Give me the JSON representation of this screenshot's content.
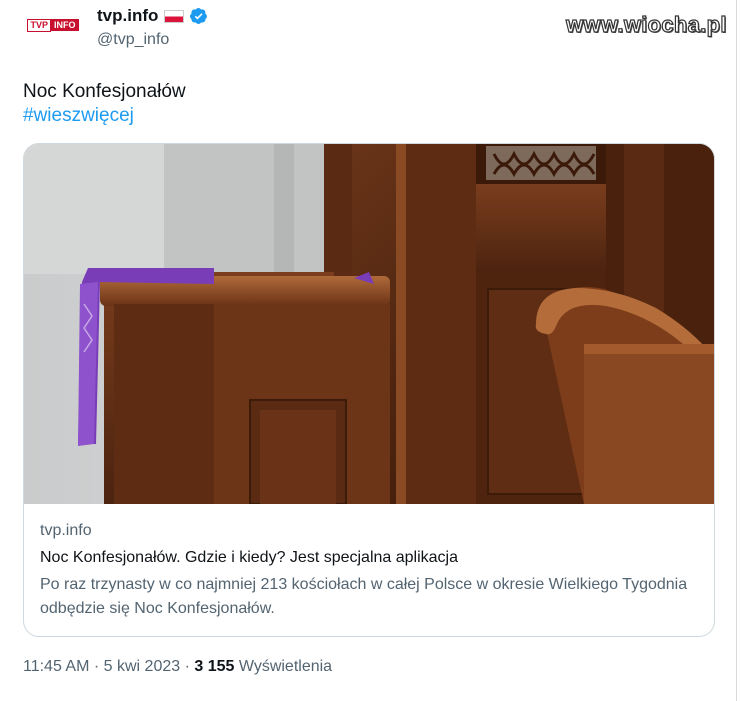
{
  "watermark": "www.wiocha.pl",
  "account": {
    "logo_text_a": "TVP",
    "logo_text_b": "INFO",
    "name": "tvp.info",
    "handle": "@tvp_info"
  },
  "tweet": {
    "text": "Noc Konfesjonałów",
    "hashtag": "#wieszwięcej"
  },
  "card": {
    "domain": "tvp.info",
    "title": "Noc Konfesjonałów. Gdzie i kiedy? Jest specjalna aplikacja",
    "description": "Po raz trzynasty w co najmniej 213 kościołach w całej Polsce w okresie Wielkiego Tygodnia odbędzie się Noc Konfesjonałów."
  },
  "meta": {
    "time": "11:45 AM",
    "sep1": " · ",
    "date": "5 kwi 2023",
    "sep2": " · ",
    "views_count": "3 155",
    "views_label": " Wyświetlenia"
  },
  "colors": {
    "link": "#1d9bf0",
    "verified": "#1d9bf0",
    "secondary_text": "#536471",
    "stole": "#7a3db8"
  }
}
